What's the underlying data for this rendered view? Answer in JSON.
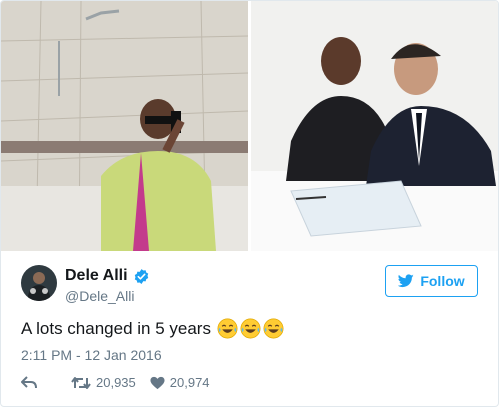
{
  "tweet": {
    "author_name": "Dele Alli",
    "author_handle": "@Dele_Alli",
    "verified": true,
    "follow_label": "Follow",
    "text": "A lots changed in 5 years",
    "emojis": [
      "face-with-tears-of-joy",
      "face-with-tears-of-joy",
      "face-with-tears-of-joy"
    ],
    "timestamp": "2:11 PM - 12 Jan 2016",
    "retweets": "20,935",
    "likes": "20,974"
  },
  "media": {
    "photos": [
      "bathroom-mirror-selfie",
      "contract-signing-photo"
    ]
  },
  "colors": {
    "accent": "#1da1f2",
    "text": "#14171a",
    "secondary": "#657786",
    "border": "#e1e8ed",
    "emoji": "#ffcc33"
  },
  "icons": {
    "verified": "verified-badge-icon",
    "follow": "twitter-bird-icon",
    "reply": "reply-icon",
    "retweet": "retweet-icon",
    "like": "heart-icon"
  }
}
